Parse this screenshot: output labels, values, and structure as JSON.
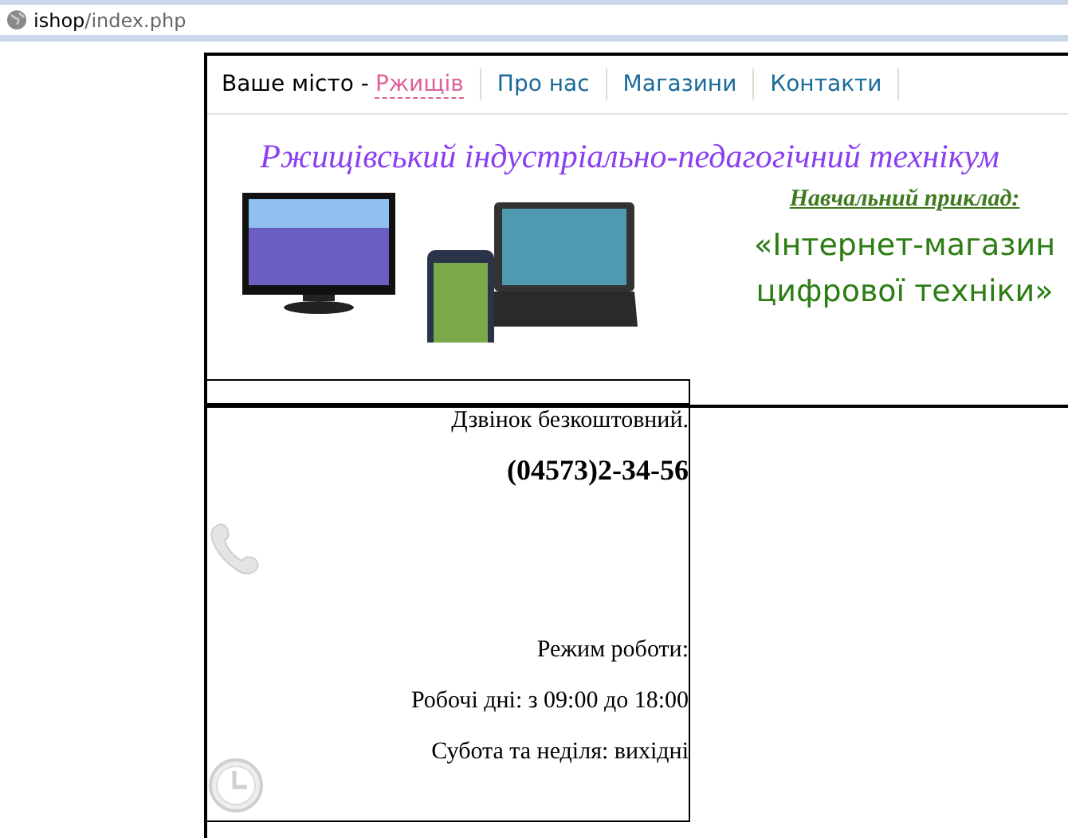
{
  "address_bar": {
    "host": "ishop",
    "path": "/index.php"
  },
  "nav": {
    "city_label": "Ваше місто -",
    "city": {
      "label": "Ржищів",
      "selected": true
    },
    "links": [
      {
        "label": "Про нас"
      },
      {
        "label": "Магазини"
      },
      {
        "label": "Контакти"
      }
    ]
  },
  "banner": {
    "title": "Ржищівський індустріально-педагогічний технікум",
    "subtitle": "Навчальний приклад:",
    "headline_lines": [
      "«Інтернет-магазин",
      "цифрової техніки»"
    ]
  },
  "contacts": {
    "call_note": "Дзвінок безкоштовний.",
    "phone": "(04573)2-34-56",
    "hours_title": "Режим роботи:",
    "weekdays": "Робочі дні: з 09:00 до 18:00",
    "weekend": "Субота та неділя: вихідні"
  }
}
